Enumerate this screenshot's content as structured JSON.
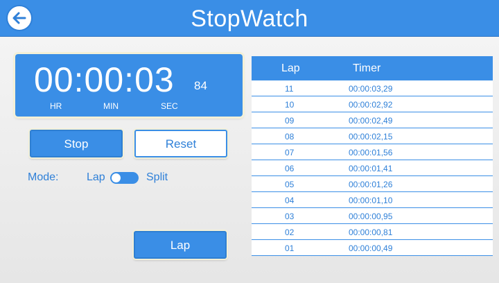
{
  "header": {
    "title": "StopWatch"
  },
  "clock": {
    "hours": "00",
    "minutes": "00",
    "seconds": "03",
    "separator": ":",
    "hundredths": "84",
    "labels": {
      "hr": "HR",
      "min": "MIN",
      "sec": "SEC"
    }
  },
  "buttons": {
    "stop": "Stop",
    "reset": "Reset",
    "lap": "Lap"
  },
  "mode": {
    "label": "Mode:",
    "left": "Lap",
    "right": "Split"
  },
  "table": {
    "headers": {
      "lap": "Lap",
      "timer": "Timer"
    },
    "rows": [
      {
        "lap": "11",
        "timer": "00:00:03,29"
      },
      {
        "lap": "10",
        "timer": "00:00:02,92"
      },
      {
        "lap": "09",
        "timer": "00:00:02,49"
      },
      {
        "lap": "08",
        "timer": "00:00:02,15"
      },
      {
        "lap": "07",
        "timer": "00:00:01,56"
      },
      {
        "lap": "06",
        "timer": "00:00:01,41"
      },
      {
        "lap": "05",
        "timer": "00:00:01,26"
      },
      {
        "lap": "04",
        "timer": "00:00:01,10"
      },
      {
        "lap": "03",
        "timer": "00:00:00,95"
      },
      {
        "lap": "02",
        "timer": "00:00:00,81"
      },
      {
        "lap": "01",
        "timer": "00:00:00,49"
      }
    ]
  },
  "colors": {
    "accent": "#3a8ee6",
    "text_blue": "#2f80d8",
    "background": "#eeeeee"
  },
  "icons": {
    "back": "back-arrow-icon"
  }
}
